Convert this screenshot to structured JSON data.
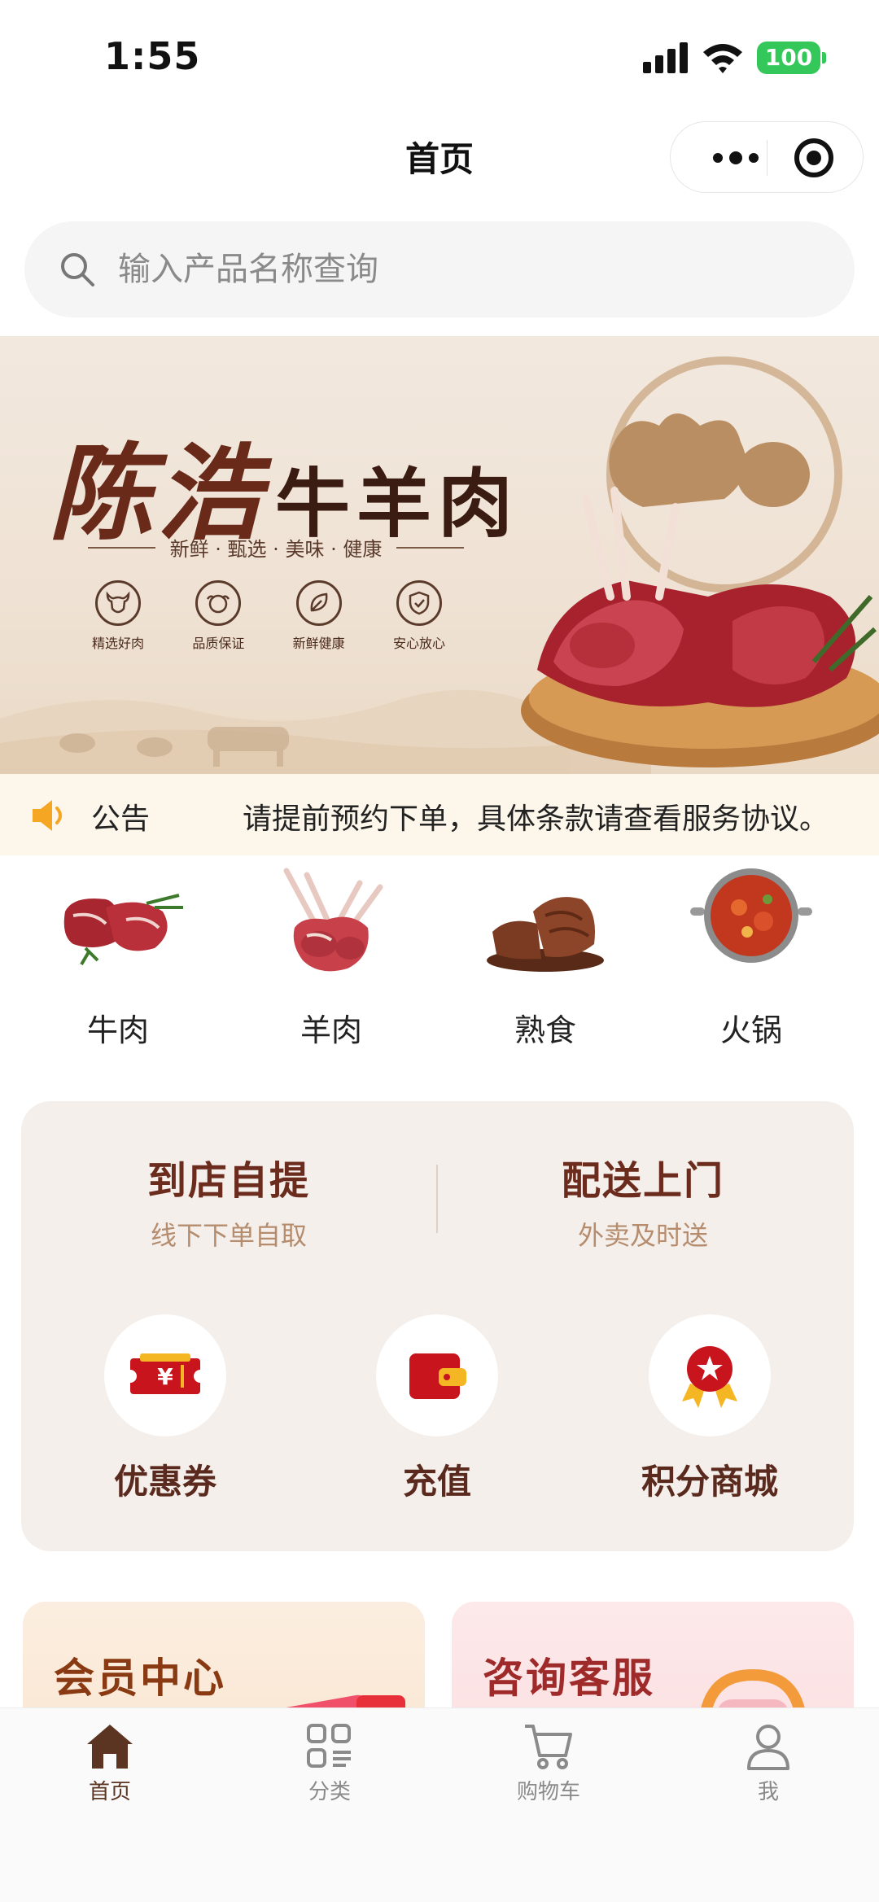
{
  "status_bar": {
    "time": "1:55",
    "battery": "100"
  },
  "nav": {
    "title": "首页"
  },
  "search": {
    "placeholder": "输入产品名称查询"
  },
  "banner": {
    "brand_name": "陈浩",
    "brand_sub": "牛羊肉",
    "tagline": "新鲜 · 甄选 · 美味 · 健康",
    "badges": [
      "精选好肉",
      "品质保证",
      "新鲜健康",
      "安心放心"
    ]
  },
  "notice": {
    "tag": "公告",
    "message": "请提前预约下单，具体条款请查看服务协议。"
  },
  "categories": [
    {
      "label": "牛肉",
      "icon": "beef-image"
    },
    {
      "label": "羊肉",
      "icon": "lamb-image"
    },
    {
      "label": "熟食",
      "icon": "cooked-food-image"
    },
    {
      "label": "火锅",
      "icon": "hotpot-image"
    }
  ],
  "service": {
    "options": [
      {
        "title": "到店自提",
        "subtitle": "线下下单自取"
      },
      {
        "title": "配送上门",
        "subtitle": "外卖及时送"
      }
    ],
    "tools": [
      {
        "label": "优惠券",
        "icon": "coupon-icon"
      },
      {
        "label": "充值",
        "icon": "wallet-icon"
      },
      {
        "label": "积分商城",
        "icon": "medal-icon"
      }
    ]
  },
  "cards": [
    {
      "title": "会员中心"
    },
    {
      "title": "咨询客服"
    }
  ],
  "tabbar": {
    "items": [
      {
        "label": "首页",
        "icon": "home-icon",
        "active": true
      },
      {
        "label": "分类",
        "icon": "category-icon",
        "active": false
      },
      {
        "label": "购物车",
        "icon": "cart-icon",
        "active": false
      },
      {
        "label": "我",
        "icon": "profile-icon",
        "active": false
      }
    ]
  },
  "colors": {
    "brand_brown": "#6b2c1d",
    "accent_green_battery": "#34c759",
    "notice_bg": "#fdf6ea",
    "card_bg": "#f4efeb"
  }
}
